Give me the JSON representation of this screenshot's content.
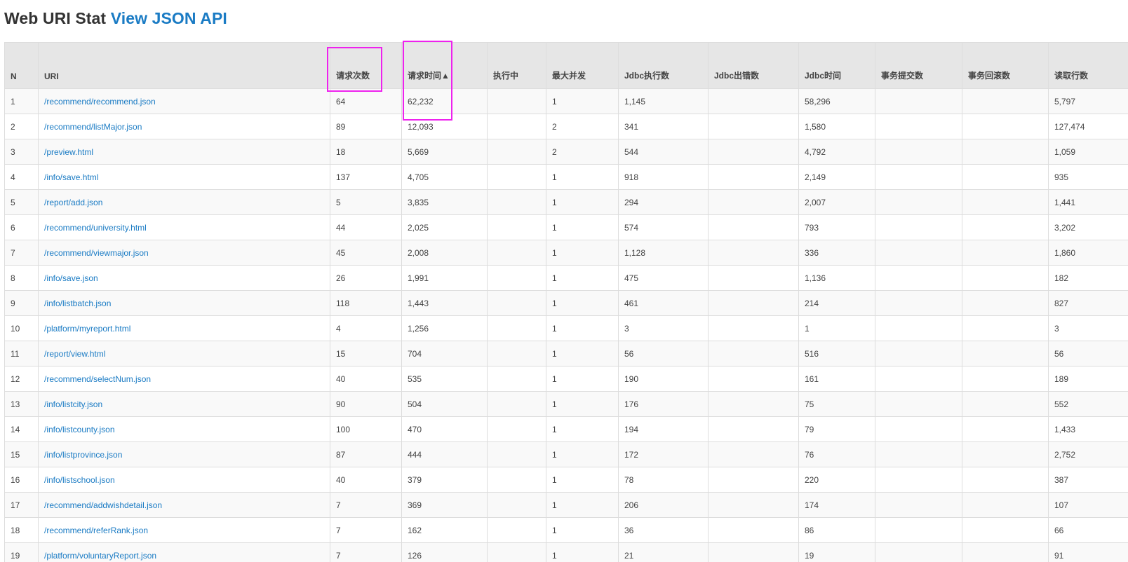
{
  "header": {
    "title": "Web URI Stat",
    "api_link": "View JSON API"
  },
  "table": {
    "columns": [
      "N",
      "URI",
      "请求次数",
      "请求时间▲",
      "执行中",
      "最大并发",
      "Jdbc执行数",
      "Jdbc出错数",
      "Jdbc时间",
      "事务提交数",
      "事务回滚数",
      "读取行数"
    ],
    "rows": [
      [
        "1",
        "/recommend/recommend.json",
        "64",
        "62,232",
        "",
        "1",
        "1,145",
        "",
        "58,296",
        "",
        "",
        "5,797"
      ],
      [
        "2",
        "/recommend/listMajor.json",
        "89",
        "12,093",
        "",
        "2",
        "341",
        "",
        "1,580",
        "",
        "",
        "127,474"
      ],
      [
        "3",
        "/preview.html",
        "18",
        "5,669",
        "",
        "2",
        "544",
        "",
        "4,792",
        "",
        "",
        "1,059"
      ],
      [
        "4",
        "/info/save.html",
        "137",
        "4,705",
        "",
        "1",
        "918",
        "",
        "2,149",
        "",
        "",
        "935"
      ],
      [
        "5",
        "/report/add.json",
        "5",
        "3,835",
        "",
        "1",
        "294",
        "",
        "2,007",
        "",
        "",
        "1,441"
      ],
      [
        "6",
        "/recommend/university.html",
        "44",
        "2,025",
        "",
        "1",
        "574",
        "",
        "793",
        "",
        "",
        "3,202"
      ],
      [
        "7",
        "/recommend/viewmajor.json",
        "45",
        "2,008",
        "",
        "1",
        "1,128",
        "",
        "336",
        "",
        "",
        "1,860"
      ],
      [
        "8",
        "/info/save.json",
        "26",
        "1,991",
        "",
        "1",
        "475",
        "",
        "1,136",
        "",
        "",
        "182"
      ],
      [
        "9",
        "/info/listbatch.json",
        "118",
        "1,443",
        "",
        "1",
        "461",
        "",
        "214",
        "",
        "",
        "827"
      ],
      [
        "10",
        "/platform/myreport.html",
        "4",
        "1,256",
        "",
        "1",
        "3",
        "",
        "1",
        "",
        "",
        "3"
      ],
      [
        "11",
        "/report/view.html",
        "15",
        "704",
        "",
        "1",
        "56",
        "",
        "516",
        "",
        "",
        "56"
      ],
      [
        "12",
        "/recommend/selectNum.json",
        "40",
        "535",
        "",
        "1",
        "190",
        "",
        "161",
        "",
        "",
        "189"
      ],
      [
        "13",
        "/info/listcity.json",
        "90",
        "504",
        "",
        "1",
        "176",
        "",
        "75",
        "",
        "",
        "552"
      ],
      [
        "14",
        "/info/listcounty.json",
        "100",
        "470",
        "",
        "1",
        "194",
        "",
        "79",
        "",
        "",
        "1,433"
      ],
      [
        "15",
        "/info/listprovince.json",
        "87",
        "444",
        "",
        "1",
        "172",
        "",
        "76",
        "",
        "",
        "2,752"
      ],
      [
        "16",
        "/info/listschool.json",
        "40",
        "379",
        "",
        "1",
        "78",
        "",
        "220",
        "",
        "",
        "387"
      ],
      [
        "17",
        "/recommend/addwishdetail.json",
        "7",
        "369",
        "",
        "1",
        "206",
        "",
        "174",
        "",
        "",
        "107"
      ],
      [
        "18",
        "/recommend/referRank.json",
        "7",
        "162",
        "",
        "1",
        "36",
        "",
        "86",
        "",
        "",
        "66"
      ],
      [
        "19",
        "/platform/voluntaryReport.json",
        "7",
        "126",
        "",
        "1",
        "21",
        "",
        "19",
        "",
        "",
        "91"
      ]
    ]
  },
  "colors": {
    "link": "#1a7bc4",
    "header_bg": "#e6e6e6",
    "stripe_bg": "#f9f9f9",
    "highlight": "#ee22ee"
  }
}
